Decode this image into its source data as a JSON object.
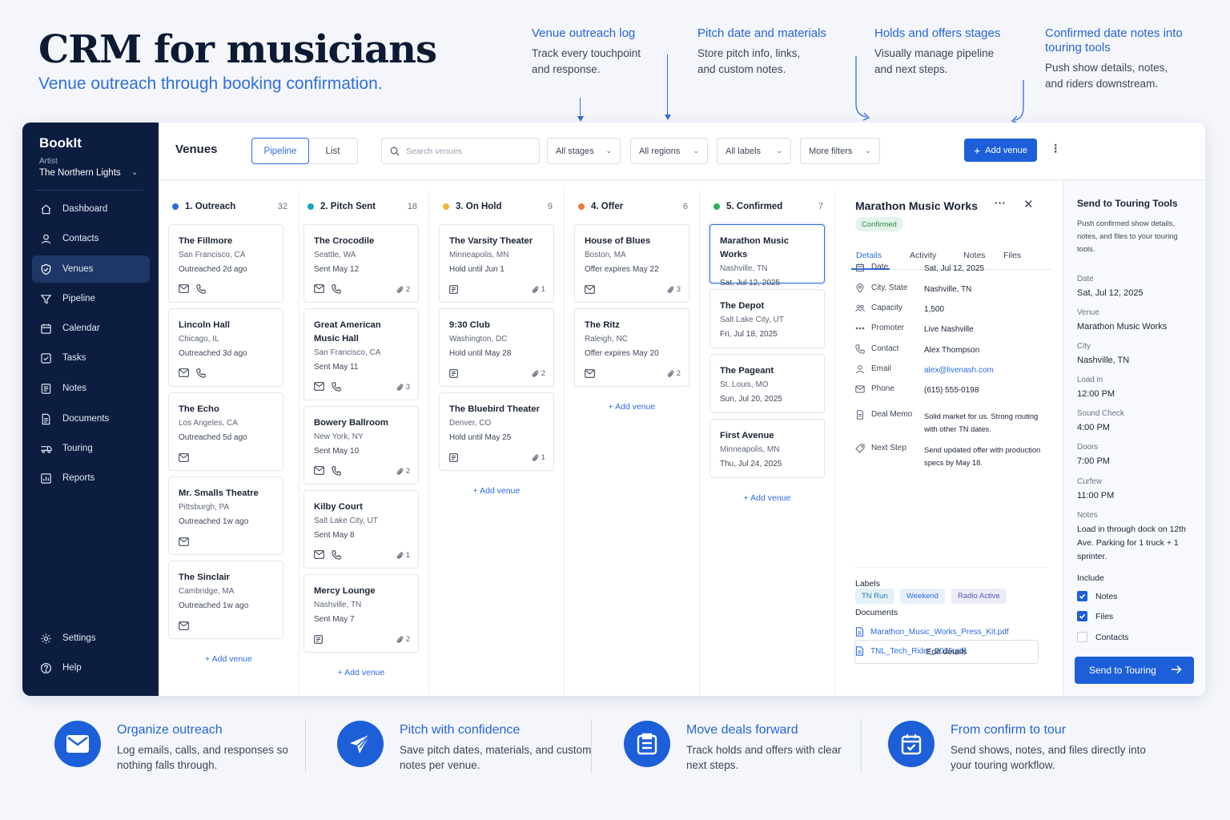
{
  "hero": {
    "title": "CRM for musicians",
    "subtitle": "Venue outreach through booking confirmation."
  },
  "callouts": [
    {
      "title": "Venue outreach log",
      "desc": "Track every touchpoint and response."
    },
    {
      "title": "Pitch date and materials",
      "desc": "Store pitch info, links, and custom notes."
    },
    {
      "title": "Holds and offers stages",
      "desc": "Visually manage pipeline and next steps."
    },
    {
      "title": "Confirmed date notes into touring tools",
      "desc": "Push show details, notes, and riders downstream."
    }
  ],
  "sidebar": {
    "brand": "BookIt",
    "artist_label": "Artist",
    "artist_name": "The Northern Lights",
    "items": [
      {
        "label": "Dashboard",
        "icon": "home-icon"
      },
      {
        "label": "Contacts",
        "icon": "user-icon"
      },
      {
        "label": "Venues",
        "icon": "shield-icon"
      },
      {
        "label": "Pipeline",
        "icon": "funnel-icon"
      },
      {
        "label": "Calendar",
        "icon": "calendar-icon"
      },
      {
        "label": "Tasks",
        "icon": "checkbox-icon"
      },
      {
        "label": "Notes",
        "icon": "note-icon"
      },
      {
        "label": "Documents",
        "icon": "document-icon"
      },
      {
        "label": "Touring",
        "icon": "touring-icon"
      },
      {
        "label": "Reports",
        "icon": "reports-icon"
      }
    ],
    "settings": "Settings",
    "help": "Help"
  },
  "toolbar": {
    "title": "Venues",
    "view_pipeline": "Pipeline",
    "view_list": "List",
    "search_placeholder": "Search venues",
    "filters": [
      "All stages",
      "All regions",
      "All labels",
      "More filters"
    ],
    "add_venue": "Add venue"
  },
  "columns": [
    {
      "title": "1. Outreach",
      "count": "32",
      "color": "#2d6cdf",
      "add": "+ Add venue",
      "cards": [
        {
          "name": "The Fillmore",
          "loc": "San Francisco, CA",
          "status": "Outreached 2d ago",
          "icons": [
            "mail",
            "phone"
          ],
          "att": ""
        },
        {
          "name": "Lincoln Hall",
          "loc": "Chicago, IL",
          "status": "Outreached 3d ago",
          "icons": [
            "mail",
            "phone"
          ],
          "att": ""
        },
        {
          "name": "The Echo",
          "loc": "Los Angeles, CA",
          "status": "Outreached 5d ago",
          "icons": [
            "mail"
          ],
          "att": ""
        },
        {
          "name": "Mr. Smalls Theatre",
          "loc": "Pittsburgh, PA",
          "status": "Outreached 1w ago",
          "icons": [
            "mail"
          ],
          "att": ""
        },
        {
          "name": "The Sinclair",
          "loc": "Cambridge, MA",
          "status": "Outreached 1w ago",
          "icons": [
            "mail"
          ],
          "att": ""
        }
      ]
    },
    {
      "title": "2. Pitch Sent",
      "count": "18",
      "color": "#1fa0c8",
      "add": "+ Add venue",
      "cards": [
        {
          "name": "The Crocodile",
          "loc": "Seattle, WA",
          "status": "Sent May 12",
          "icons": [
            "mail",
            "phone"
          ],
          "att": "2"
        },
        {
          "name": "Great American Music Hall",
          "loc": "San Francisco, CA",
          "status": "Sent May 11",
          "icons": [
            "mail",
            "phone"
          ],
          "att": "3"
        },
        {
          "name": "Bowery Ballroom",
          "loc": "New York, NY",
          "status": "Sent May 10",
          "icons": [
            "mail",
            "phone"
          ],
          "att": "2"
        },
        {
          "name": "Kilby Court",
          "loc": "Salt Lake City, UT",
          "status": "Sent May 8",
          "icons": [
            "mail",
            "phone"
          ],
          "att": "1"
        },
        {
          "name": "Mercy Lounge",
          "loc": "Nashville, TN",
          "status": "Sent May 7",
          "icons": [
            "note"
          ],
          "att": "2"
        }
      ]
    },
    {
      "title": "3. On Hold",
      "count": "9",
      "color": "#f2b33d",
      "add": "+ Add venue",
      "cards": [
        {
          "name": "The Varsity Theater",
          "loc": "Minneapolis, MN",
          "status": "Hold until Jun 1",
          "icons": [
            "note"
          ],
          "att": "1"
        },
        {
          "name": "9:30 Club",
          "loc": "Washington, DC",
          "status": "Hold until May 28",
          "icons": [
            "note"
          ],
          "att": "2"
        },
        {
          "name": "The Bluebird Theater",
          "loc": "Denver, CO",
          "status": "Hold until May 25",
          "icons": [
            "note"
          ],
          "att": "1"
        }
      ]
    },
    {
      "title": "4. Offer",
      "count": "6",
      "color": "#f07a3d",
      "add": "+ Add venue",
      "cards": [
        {
          "name": "House of Blues",
          "loc": "Boston, MA",
          "status": "Offer expires May 22",
          "icons": [
            "mail"
          ],
          "att": "3"
        },
        {
          "name": "The Ritz",
          "loc": "Raleigh, NC",
          "status": "Offer expires May 20",
          "icons": [
            "mail"
          ],
          "att": "2"
        }
      ]
    },
    {
      "title": "5. Confirmed",
      "count": "7",
      "color": "#2fae5b",
      "add": "+ Add venue",
      "cards": [
        {
          "name": "Marathon Music Works",
          "loc": "Nashville, TN",
          "status": "Sat, Jul 12, 2025",
          "icons": [],
          "att": ""
        },
        {
          "name": "The Depot",
          "loc": "Salt Lake City, UT",
          "status": "Fri, Jul 18, 2025",
          "icons": [],
          "att": ""
        },
        {
          "name": "The Pageant",
          "loc": "St. Louis, MO",
          "status": "Sun, Jul 20, 2025",
          "icons": [],
          "att": ""
        },
        {
          "name": "First Avenue",
          "loc": "Minneapolis, MN",
          "status": "Thu, Jul 24, 2025",
          "icons": [],
          "att": ""
        }
      ]
    }
  ],
  "detail": {
    "title": "Marathon Music Works",
    "badge": "Confirmed",
    "tabs": [
      "Details",
      "Activity",
      "Notes",
      "Files"
    ],
    "rows": [
      {
        "icon": "calendar-icon",
        "k": "Date",
        "v": "Sat, Jul 12, 2025"
      },
      {
        "icon": "pin-icon",
        "k": "City, State",
        "v": "Nashville, TN"
      },
      {
        "icon": "people-icon",
        "k": "Capacity",
        "v": "1,500"
      },
      {
        "icon": "dots-icon",
        "k": "Promoter",
        "v": "Live Nashville"
      },
      {
        "icon": "phone-icon",
        "k": "Contact",
        "v": "Alex Thompson"
      },
      {
        "icon": "user-icon",
        "k": "Email",
        "v": "alex@livenash.com"
      },
      {
        "icon": "mail-icon",
        "k": "Phone",
        "v": "(615) 555-0198"
      },
      {
        "icon": "document-icon",
        "k": "Deal Memo",
        "v": "Solid market for us. Strong routing with other TN dates."
      },
      {
        "icon": "tag-icon",
        "k": "Next Step",
        "v": "Send updated offer with production specs by May 18."
      }
    ],
    "labels_title": "Labels",
    "labels": [
      "TN Run",
      "Weekend",
      "Radio Active"
    ],
    "documents_title": "Documents",
    "documents": [
      "Marathon_Music_Works_Press_Kit.pdf",
      "TNL_Tech_Rider_2025.pdf"
    ],
    "edit": "Edit details"
  },
  "touring": {
    "title": "Send to Touring Tools",
    "desc": "Push confirmed show details, notes, and files to your touring tools.",
    "fields": [
      {
        "k": "Date",
        "v": "Sat, Jul 12, 2025"
      },
      {
        "k": "Venue",
        "v": "Marathon Music Works"
      },
      {
        "k": "City",
        "v": "Nashville, TN"
      },
      {
        "k": "Load in",
        "v": "12:00 PM"
      },
      {
        "k": "Sound Check",
        "v": "4:00 PM"
      },
      {
        "k": "Doors",
        "v": "7:00 PM"
      },
      {
        "k": "Curfew",
        "v": "11:00 PM"
      },
      {
        "k": "Notes",
        "v": "Load in through dock on 12th Ave. Parking for 1 truck + 1 sprinter."
      }
    ],
    "include_title": "Include",
    "include": [
      {
        "label": "Notes",
        "checked": true
      },
      {
        "label": "Files",
        "checked": true
      },
      {
        "label": "Contacts",
        "checked": false
      }
    ],
    "send": "Send to Touring"
  },
  "features": [
    {
      "title": "Organize outreach",
      "desc": "Log emails, calls, and responses so nothing falls through.",
      "icon": "envelope-icon"
    },
    {
      "title": "Pitch with confidence",
      "desc": "Save pitch dates, materials, and custom notes per venue.",
      "icon": "paper-plane-icon"
    },
    {
      "title": "Move deals forward",
      "desc": "Track holds and offers with clear next steps.",
      "icon": "clipboard-icon"
    },
    {
      "title": "From confirm to tour",
      "desc": "Send shows, notes, and files directly into your touring workflow.",
      "icon": "calendar-check-icon"
    }
  ]
}
